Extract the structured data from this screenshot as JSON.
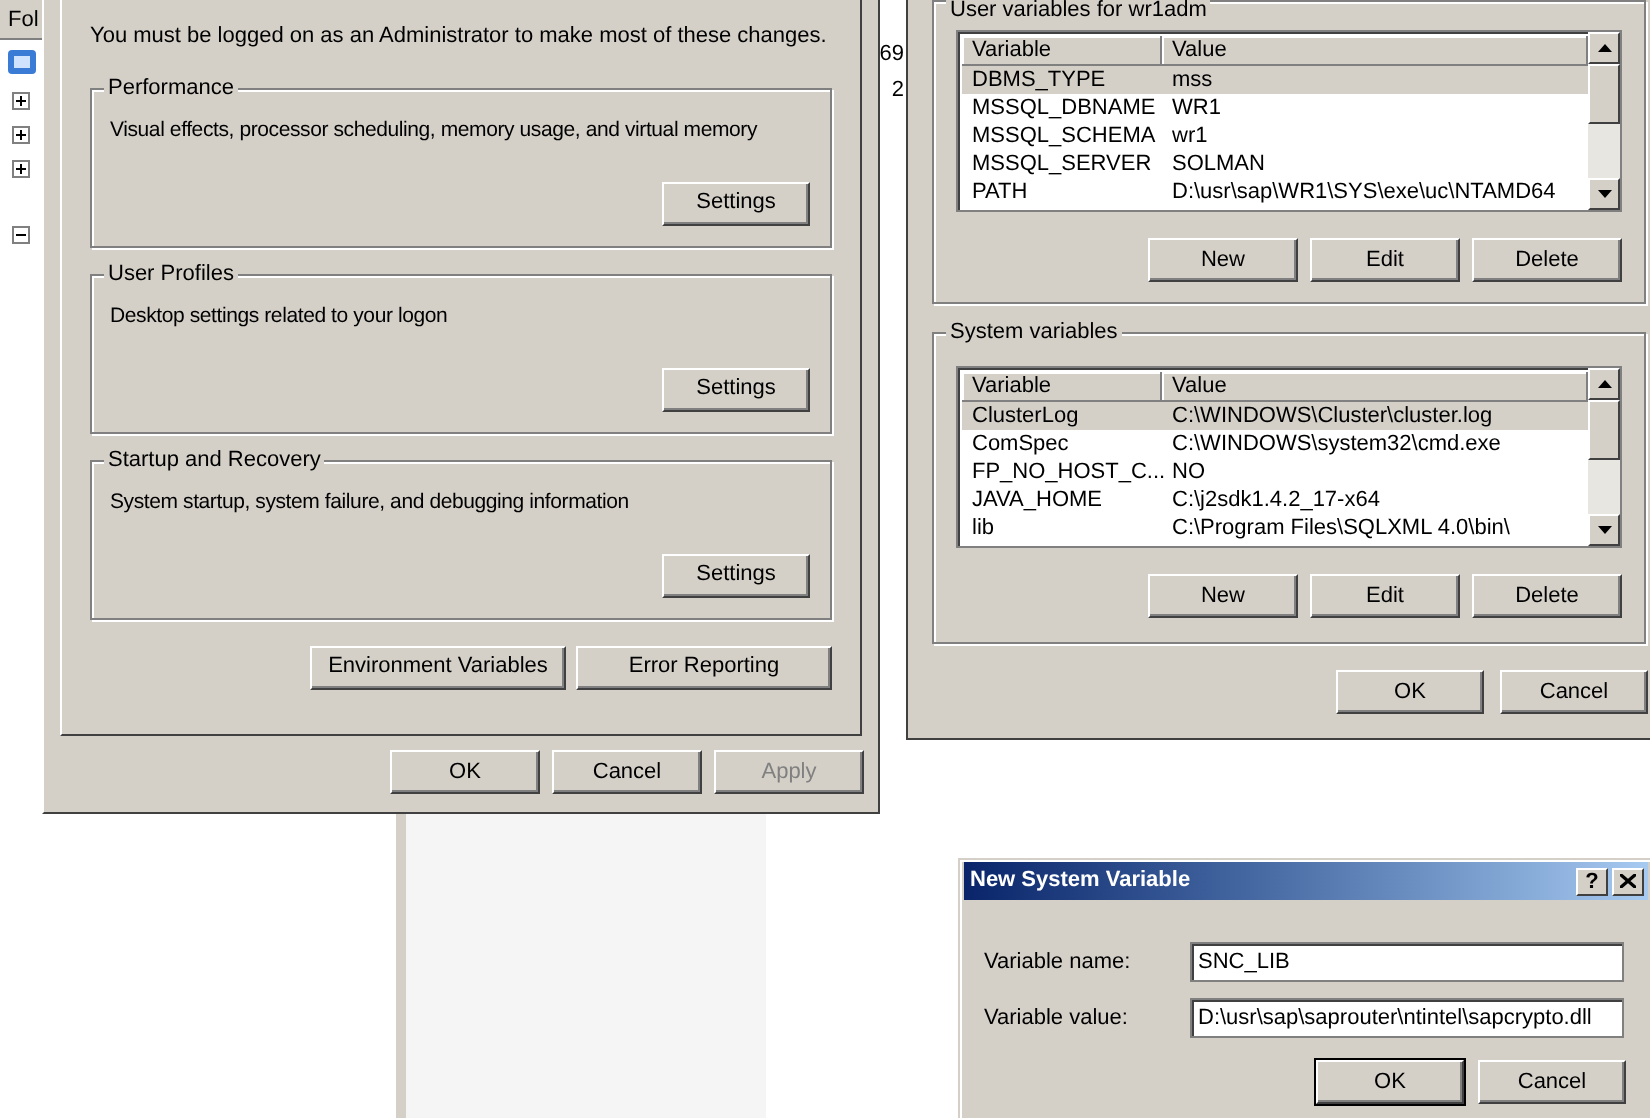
{
  "explorer": {
    "header": "Fol",
    "cells": [
      "69",
      "2"
    ],
    "tree": [
      {
        "expanded": false
      },
      {
        "expanded": false
      },
      {
        "expanded": false
      },
      {
        "expanded": true
      }
    ]
  },
  "system_properties": {
    "notice": "You must be logged on as an Administrator to make most of these changes.",
    "groups": [
      {
        "title": "Performance",
        "description": "Visual effects, processor scheduling, memory usage, and virtual memory",
        "button": "Settings"
      },
      {
        "title": "User Profiles",
        "description": "Desktop settings related to your logon",
        "button": "Settings"
      },
      {
        "title": "Startup and Recovery",
        "description": "System startup, system failure, and debugging information",
        "button": "Settings"
      }
    ],
    "buttons": [
      "Environment Variables",
      "Error Reporting"
    ],
    "footer_buttons": [
      {
        "label": "OK",
        "disabled": false
      },
      {
        "label": "Cancel",
        "disabled": false
      },
      {
        "label": "Apply",
        "disabled": true
      }
    ]
  },
  "environment_variables": {
    "groups": [
      {
        "title": "User variables for wr1adm",
        "columns": [
          "Variable",
          "Value"
        ],
        "rows": [
          {
            "variable": "DBMS_TYPE",
            "value": "mss",
            "selected": true
          },
          {
            "variable": "MSSQL_DBNAME",
            "value": "WR1",
            "selected": false
          },
          {
            "variable": "MSSQL_SCHEMA",
            "value": "wr1",
            "selected": false
          },
          {
            "variable": "MSSQL_SERVER",
            "value": "SOLMAN",
            "selected": false
          },
          {
            "variable": "PATH",
            "value": "D:\\usr\\sap\\WR1\\SYS\\exe\\uc\\NTAMD64",
            "selected": false
          }
        ],
        "buttons": [
          "New",
          "Edit",
          "Delete"
        ]
      },
      {
        "title": "System variables",
        "columns": [
          "Variable",
          "Value"
        ],
        "rows": [
          {
            "variable": "ClusterLog",
            "value": "C:\\WINDOWS\\Cluster\\cluster.log",
            "selected": true
          },
          {
            "variable": "ComSpec",
            "value": "C:\\WINDOWS\\system32\\cmd.exe",
            "selected": false
          },
          {
            "variable": "FP_NO_HOST_C...",
            "value": "NO",
            "selected": false
          },
          {
            "variable": "JAVA_HOME",
            "value": "C:\\j2sdk1.4.2_17-x64",
            "selected": false
          },
          {
            "variable": "lib",
            "value": "C:\\Program Files\\SQLXML 4.0\\bin\\",
            "selected": false
          }
        ],
        "buttons": [
          "New",
          "Edit",
          "Delete"
        ]
      }
    ],
    "buttons": [
      "OK",
      "Cancel"
    ]
  },
  "new_variable_dialog": {
    "title": "New System Variable",
    "help": "?",
    "fields": [
      {
        "label": "Variable name:",
        "value": "SNC_LIB"
      },
      {
        "label": "Variable value:",
        "value": "D:\\usr\\sap\\saprouter\\ntintel\\sapcrypto.dll"
      }
    ],
    "buttons": [
      {
        "label": "OK",
        "default": true
      },
      {
        "label": "Cancel",
        "default": false
      }
    ]
  }
}
